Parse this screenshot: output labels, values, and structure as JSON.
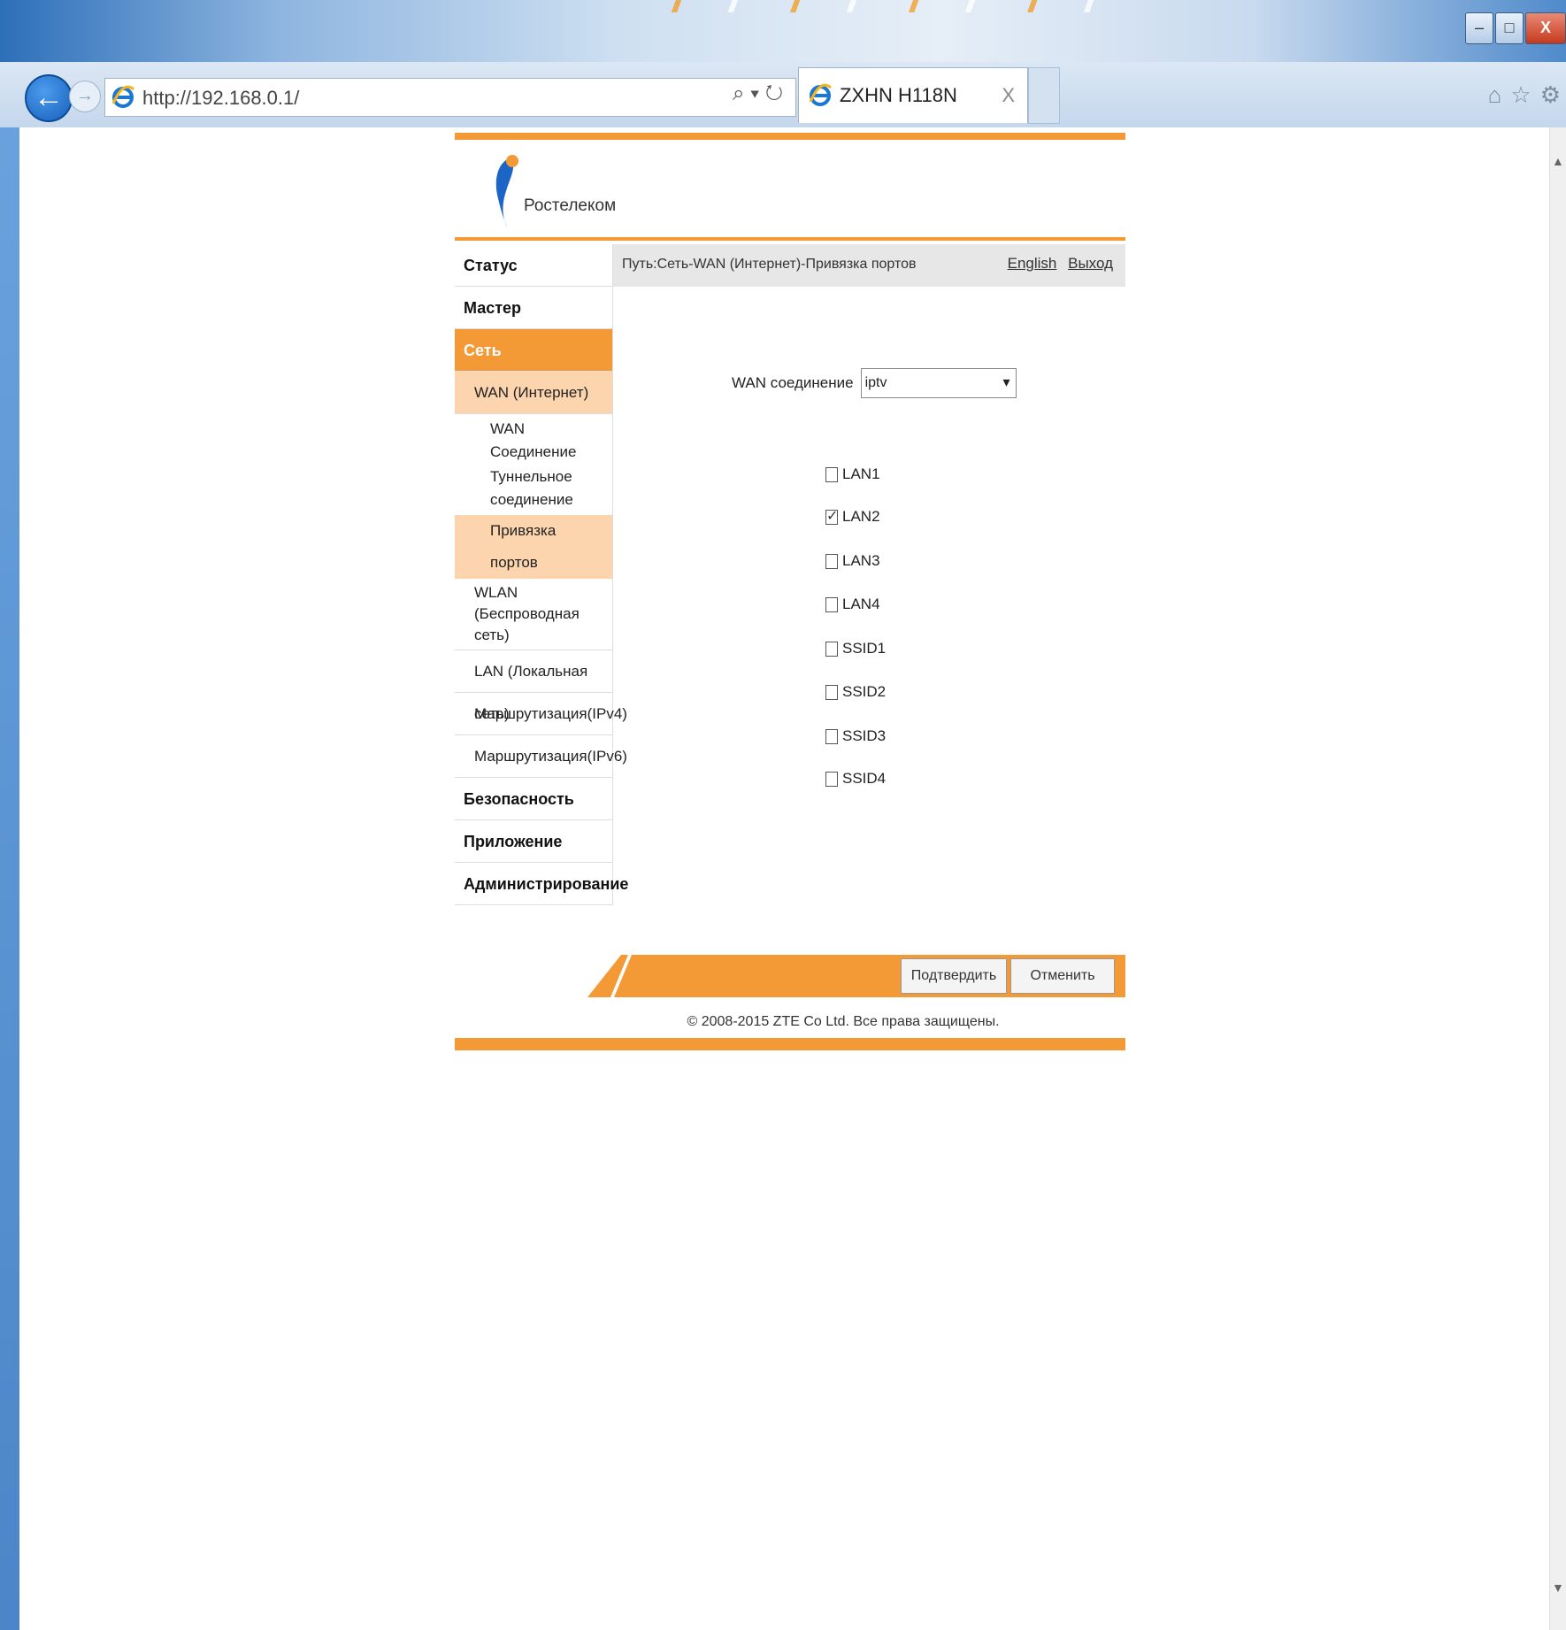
{
  "browser": {
    "url": "http://192.168.0.1/",
    "tab_title": "ZXHN H118N",
    "tab_close": "X",
    "window_buttons": [
      "–",
      "□",
      "X"
    ]
  },
  "brand": {
    "logo_text": "Ростелеком",
    "accent_color": "#f39a36",
    "highlight_color": "#fcd4ad"
  },
  "menu": {
    "status": "Статус",
    "wizard": "Мастер",
    "network": "Сеть",
    "wan": "WAN (Интернет)",
    "wan_connection": "WAN Соединение",
    "tunnel": "Туннельное соединение",
    "port_binding": "Привязка портов",
    "wlan": "WLAN (Беспроводная сеть)",
    "lan": "LAN (Локальная сеть)",
    "routing_v4": "Маршрутизация(IPv4)",
    "routing_v6": "Маршрутизация(IPv6)",
    "security": "Безопасность",
    "application": "Приложение",
    "administration": "Администрирование"
  },
  "header": {
    "path": "Путь:Сеть-WAN (Интернет)-Привязка портов",
    "english": "English",
    "logout": "Выход"
  },
  "form": {
    "wan_label": "WAN соединение",
    "wan_value": "iptv",
    "ports": [
      {
        "label": "LAN1",
        "checked": false
      },
      {
        "label": "LAN2",
        "checked": true
      },
      {
        "label": "LAN3",
        "checked": false
      },
      {
        "label": "LAN4",
        "checked": false
      },
      {
        "label": "SSID1",
        "checked": false
      },
      {
        "label": "SSID2",
        "checked": false
      },
      {
        "label": "SSID3",
        "checked": false
      },
      {
        "label": "SSID4",
        "checked": false
      }
    ]
  },
  "buttons": {
    "confirm": "Подтвердить",
    "cancel": "Отменить"
  },
  "footer": {
    "copyright": "© 2008-2015 ZTE Co Ltd. Все права защищены."
  }
}
